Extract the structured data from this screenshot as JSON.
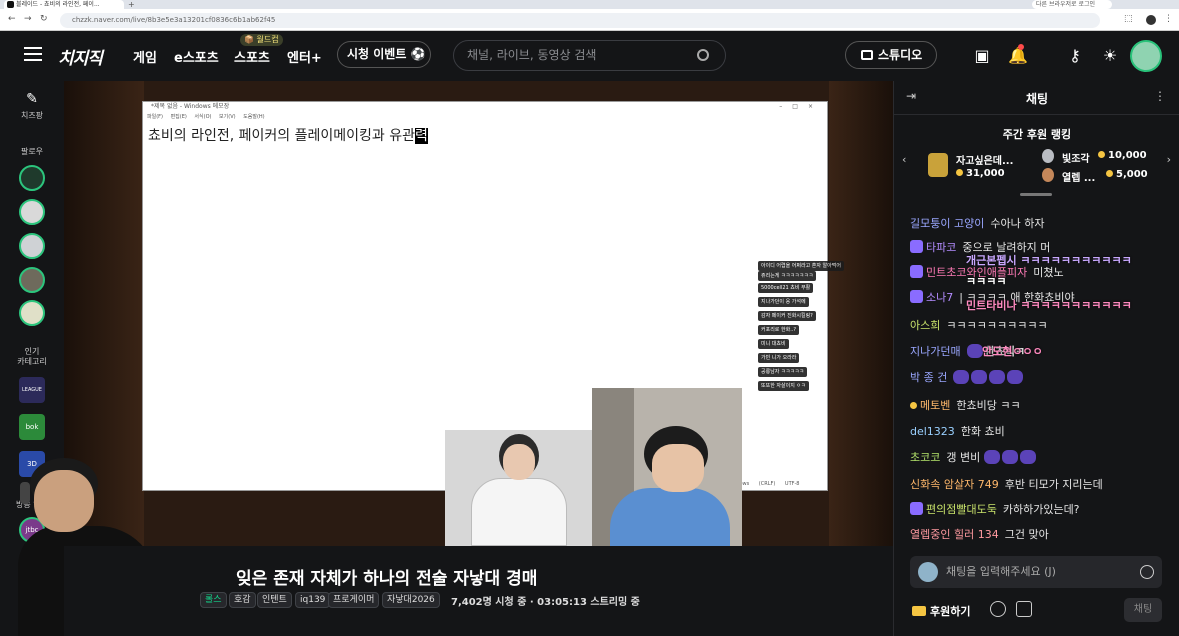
{
  "browser": {
    "tab_title": "블레이드 - 쵸비의 라인전, 페이...",
    "url": "chzzk.naver.com/live/8b3e5e3a13201cf0836c6b1ab62f45",
    "profile_chip": "다른 브라우저로 로그인"
  },
  "header": {
    "logo": "치지직",
    "nav": [
      "게임",
      "e스포츠",
      "스포츠",
      "엔터+"
    ],
    "drops_badge": "📦 월드컵",
    "event_button": "시청 이벤트 ⚽",
    "search_placeholder": "채널, 라이브, 동영상 검색",
    "studio_button": "스튜디오"
  },
  "sidebar": {
    "cheese_label": "치즈팡",
    "follow_label": "팔로우",
    "category_label": "인기\n카테고리",
    "schedule_label": "방송 일정",
    "category_badges": [
      "LEAGUE",
      "bok",
      "3D"
    ],
    "schedule_badges": [
      "jtbc"
    ]
  },
  "notepad": {
    "window_title": "*제목 없음 - Windows 메모장",
    "menu": "파일(F) 편집(E) 서식(O) 보기(V) 도움말(H)",
    "text_main": "쵸비의 라인전, 페이커의 플레이메이킹과 유관",
    "text_selected": "력",
    "status": "100% Windows (CRLF) UTF-8"
  },
  "overlay_chat": [
    "아이디 어렵을 어쩌라고 혼자 알아먹어",
    "쥬리는게 ㅋㅋㅋㅋㅋㅋㅋ",
    "5000cell21 쵸비 부활",
    "지나가던이 응 가석에",
    "감자 페이커 진화시킬링?",
    "커포리로 한화..?",
    "미니 대쵸비",
    "가빈 니가 오라라",
    "공룡남자 ㅋㅋㅋㅋㅋ",
    "또또한 자살이지 ㅇㅋ"
  ],
  "stream": {
    "title": "잊은 존재 자체가 하나의 전술 자낳대 경매",
    "tags": [
      "롤스",
      "호감",
      "인텐트",
      "iq139",
      "프로게이머",
      "자낳대2026"
    ],
    "viewers": "7,402명 시청 중 · 03:05:13 스트리밍 중"
  },
  "chat": {
    "title": "채팅",
    "ranking_title": "주간 후원 랭킹",
    "ranking": [
      {
        "name": "자고싶은데...",
        "amount": "31,000"
      },
      {
        "name": "빛조각",
        "amount": "10,000"
      },
      {
        "name": "열렙 ...",
        "amount": "5,000"
      }
    ],
    "messages": [
      {
        "nick": "길모퉁이 고양이",
        "color": "#9aa7ff",
        "text": "수아나 하자",
        "badge": false
      },
      {
        "nick": "타파코",
        "color": "#b38cff",
        "text": "중으로 날려하지 머",
        "badge": true
      },
      {
        "nick": "민트초코와인애플피자",
        "color": "#ff7ab6",
        "text": "미쳤노",
        "badge": true
      },
      {
        "nick": "소나7",
        "color": "#b38cff",
        "text": "| ㅋㅋㅋㅋ 애 한화쵸비야",
        "badge": true
      },
      {
        "nick": "아스희",
        "color": "#c9e36b",
        "text": "ㅋㅋㅋㅋㅋㅋㅋㅋㅋㅋ",
        "badge": false
      },
      {
        "nick": "지나가던매",
        "color": "#9aa7ff",
        "text": "한쵸빅ㅋ",
        "badge": false
      },
      {
        "nick": "박 종 건",
        "color": "#9aa7ff",
        "text": "",
        "badge": false
      },
      {
        "nick": "메토벤",
        "color": "#ffb86b",
        "text": "한쵸비당 ㅋㅋ",
        "badge": false
      },
      {
        "nick": "del1323",
        "color": "#9ad0ff",
        "text": "한화 쵸비",
        "badge": false
      },
      {
        "nick": "초코코",
        "color": "#b3e36b",
        "text": "갱 변비",
        "badge": false
      },
      {
        "nick": "신화속 암살자 749",
        "color": "#ffb86b",
        "text": "후반 티모가 지리는데",
        "badge": false
      },
      {
        "nick": "편의점빨대도둑",
        "color": "#c9e36b",
        "text": "카하하가있는데?",
        "badge": true
      },
      {
        "nick": "열렙중인 힐러 134",
        "color": "#ff9aa0",
        "text": "그건 맞아",
        "badge": false
      }
    ],
    "ghost_texts": [
      "개근본펩시 ㅋㅋㅋㅋㅋㅋㅋㅋㅋㅋㅋ",
      "ㅋㅋㅋㅋ",
      "민트타비나 ㅋㅋㅋㅋㅋㅋㅋㅋㅋㅋㅋ",
      "안도현ㅇㅇㅇ"
    ],
    "input_placeholder": "채팅을 입력해주세요 (J)",
    "donate_label": "후원하기",
    "send_label": "채팅"
  }
}
